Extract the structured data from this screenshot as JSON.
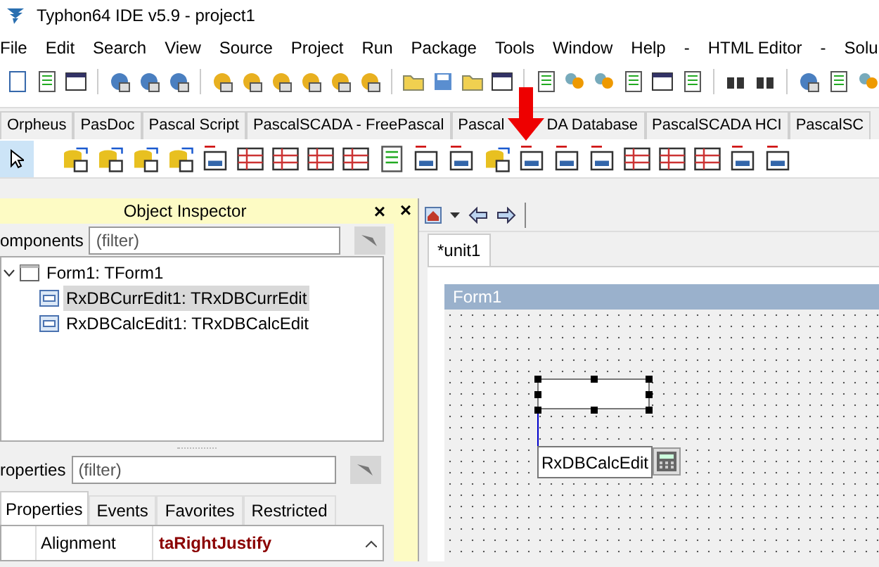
{
  "window": {
    "title": "Typhon64 IDE v5.9 - project1"
  },
  "menu": [
    "File",
    "Edit",
    "Search",
    "View",
    "Source",
    "Project",
    "Run",
    "Package",
    "Tools",
    "Window",
    "Help",
    "-",
    "HTML Editor",
    "-",
    "Solu"
  ],
  "palette_tabs": [
    {
      "parts": [
        "Orpheus"
      ]
    },
    {
      "parts": [
        "PasDoc"
      ]
    },
    {
      "parts": [
        "Pascal Script"
      ]
    },
    {
      "parts": [
        "PascalSCADA - FreePascal"
      ]
    },
    {
      "parts": [
        "Pascal",
        "DA Database"
      ]
    },
    {
      "parts": [
        "PascalSCADA HCI"
      ]
    },
    {
      "parts": [
        "PascalSC"
      ]
    }
  ],
  "object_inspector": {
    "title": "Object Inspector",
    "close": "×",
    "components_label": "omponents",
    "components_filter": {
      "placeholder": "(filter)"
    },
    "tree": [
      {
        "label": "Form1: TForm1",
        "expanded": true,
        "selected": false,
        "children": [
          {
            "label": "RxDBCurrEdit1: TRxDBCurrEdit",
            "selected": true
          },
          {
            "label": "RxDBCalcEdit1: TRxDBCalcEdit",
            "selected": false
          }
        ]
      }
    ],
    "properties_label": "roperties",
    "properties_filter": {
      "placeholder": "(filter)"
    },
    "tabs": [
      {
        "label": "Properties",
        "selected": true
      },
      {
        "label": "Events",
        "selected": false
      },
      {
        "label": "Favorites",
        "selected": false
      },
      {
        "label": "Restricted",
        "selected": false
      }
    ],
    "grid": [
      {
        "name": "Alignment",
        "value": "taRightJustify"
      }
    ]
  },
  "dock_close": "×",
  "editor": {
    "tabs": [
      {
        "label": "*unit1",
        "selected": true
      }
    ],
    "form": {
      "title": "Form1",
      "component_label": "RxDBCalcEdit"
    }
  }
}
